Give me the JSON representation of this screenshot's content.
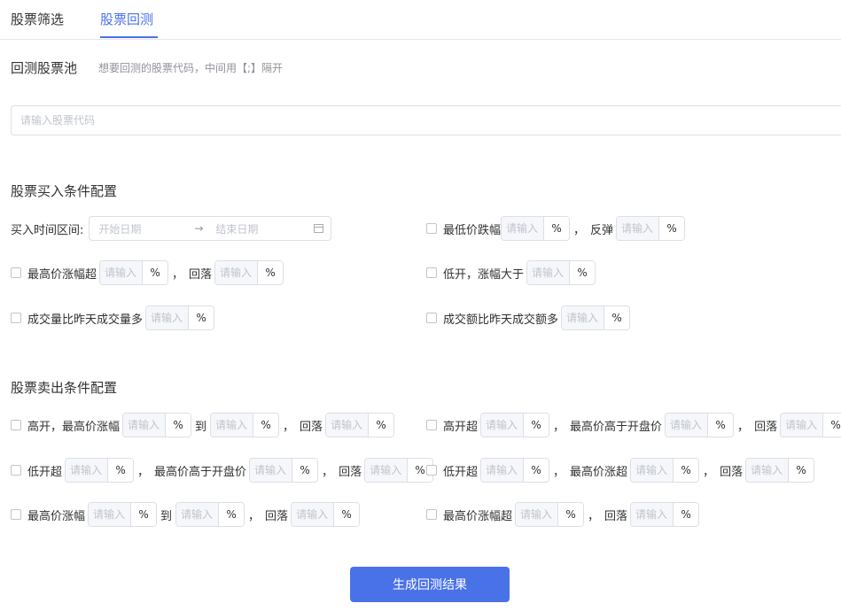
{
  "tabs": [
    {
      "label": "股票筛选"
    },
    {
      "label": "股票回测"
    }
  ],
  "pool": {
    "title": "回测股票池",
    "hint": "想要回测的股票代码，中间用【;】隔开",
    "placeholder": "请输入股票代码"
  },
  "common": {
    "input_placeholder": "请输入",
    "percent": "%",
    "comma": "，",
    "to": "到"
  },
  "buy": {
    "title": "股票买入条件配置",
    "time_label": "买入时间区间:",
    "start_placeholder": "开始日期",
    "end_placeholder": "结束日期",
    "low_drop": "最低价跌幅",
    "rebound": "反弹",
    "high_rise": "最高价涨幅超",
    "fallback": "回落",
    "low_open": "低开，涨幅大于",
    "volume_more": "成交量比昨天成交量多",
    "amount_more": "成交额比昨天成交额多"
  },
  "sell": {
    "title": "股票卖出条件配置",
    "high_open": "高开，最高价涨幅",
    "to": "到",
    "fallback": "回落",
    "high_open_over": "高开超",
    "high_above_open": "最高价高于开盘价",
    "low_open_over": "低开超",
    "high_rise_over": "最高价涨超",
    "high_rise": "最高价涨幅",
    "high_rise_over2": "最高价涨幅超"
  },
  "submit_label": "生成回测结果",
  "colors": {
    "accent": "#4a72e8",
    "border": "#dcdfe6",
    "placeholder": "#c0c4cc"
  }
}
